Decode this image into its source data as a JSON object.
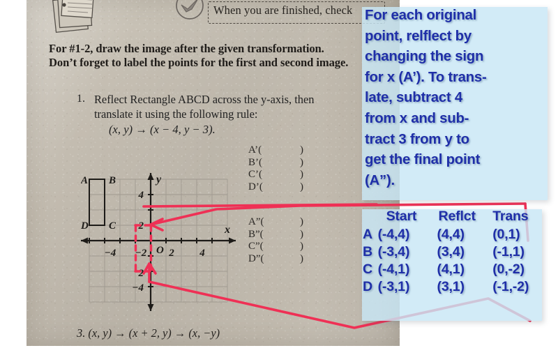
{
  "worksheet": {
    "check_note": "When you are finished, check",
    "heading_line1": "For #1-2, draw the image after the given transformation.",
    "heading_line2": "Don’t forget to label the points for the first and second image.",
    "q1_number": "1.",
    "q1_line1": "Reflect Rectangle ABCD across the y-axis, then",
    "q1_line2": "translate it using the following rule:",
    "q1_rule": "(x, y) → (x − 4, y − 3).",
    "q3": "3.  (x, y) → (x + 2, y) → (x, −y)",
    "blanks_prime": [
      "A’(",
      "B’(",
      "C’(",
      "D’("
    ],
    "blanks_dprime": [
      "A”(",
      "B”(",
      "C”(",
      "D”("
    ],
    "blank_close": ")"
  },
  "graph": {
    "x_axis_label": "x",
    "y_axis_label": "y",
    "origin_label": "O",
    "x_ticks": [
      "−4",
      "−2",
      "2",
      "4"
    ],
    "y_ticks": [
      "4",
      "2",
      "2",
      "4"
    ],
    "rect_labels": [
      "A",
      "B",
      "D",
      "C"
    ],
    "rect_points": {
      "A": [
        -4,
        4
      ],
      "B": [
        -3,
        4
      ],
      "C": [
        -3,
        1
      ],
      "D": [
        -4,
        1
      ]
    },
    "pen_rect_points": {
      "A2": [
        -1,
        1
      ],
      "B2": [
        0,
        1
      ],
      "C2": [
        0,
        -2
      ],
      "D2": [
        -1,
        -2
      ]
    }
  },
  "annotation": {
    "note": "For each original point, relflect by changing the sign for x (A’).  To translate, subtract 4 from x and subtract 3 from y to get the final point (A”).",
    "note_lines": [
      "For each original",
      "point, relflect by",
      "changing the sign",
      "for x (A’).  To trans-",
      "late, subtract 4",
      "from x and sub-",
      "tract 3 from y to",
      "get the final point",
      "(A”)."
    ],
    "panel_color": "#c8e6f5",
    "text_color": "#1f2fa8",
    "pen_color": "#ef3055"
  },
  "chart_data": {
    "type": "table",
    "title": "",
    "columns": [
      "",
      "Start",
      "Reflct",
      "Trans"
    ],
    "rows": [
      [
        "A",
        "(-4,4)",
        "(4,4)",
        "(0,1)"
      ],
      [
        "B",
        "(-3,4)",
        "(3,4)",
        "(-1,1)"
      ],
      [
        "C",
        "(-4,1)",
        "(4,1)",
        "(0,-2)"
      ],
      [
        "D",
        "(-3,1)",
        "(3,1)",
        "(-1,-2)"
      ]
    ]
  }
}
